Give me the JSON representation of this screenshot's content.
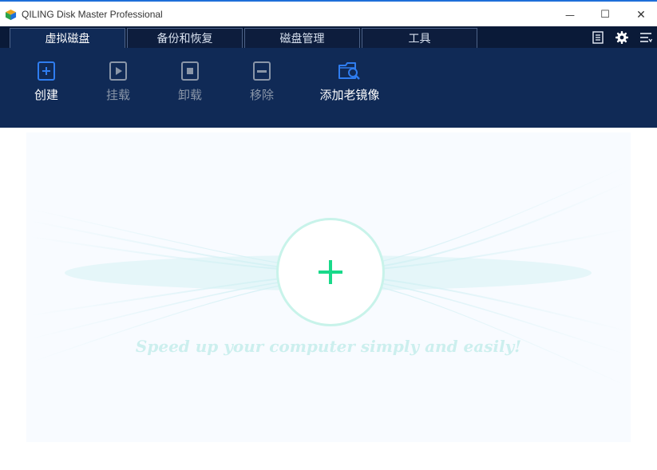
{
  "window": {
    "title": "QILING Disk Master Professional",
    "minimize_glyph": "—",
    "maximize_glyph": "☐",
    "close_glyph": "✕"
  },
  "tabs": [
    {
      "label": "虚拟磁盘",
      "active": true
    },
    {
      "label": "备份和恢复",
      "active": false
    },
    {
      "label": "磁盘管理",
      "active": false
    },
    {
      "label": "工具",
      "active": false
    }
  ],
  "top_icons": [
    "notes-icon",
    "gear-icon",
    "menu-icon"
  ],
  "toolbar": {
    "create": {
      "label": "创建",
      "icon": "create-plus-icon",
      "enabled": true
    },
    "mount": {
      "label": "挂载",
      "icon": "mount-play-icon",
      "enabled": false
    },
    "unmount": {
      "label": "卸载",
      "icon": "unmount-stop-icon",
      "enabled": false
    },
    "remove": {
      "label": "移除",
      "icon": "remove-minus-icon",
      "enabled": false
    },
    "add_image": {
      "label": "添加老镜像",
      "icon": "folder-search-icon",
      "enabled": true
    }
  },
  "main": {
    "add_button_icon": "plus-icon",
    "slogan": "Speed up your computer simply and easily!"
  },
  "colors": {
    "accent_blue": "#1e6fd9",
    "toolbar_bg": "#102a56",
    "tabbar_bg": "#0a1a38",
    "plus_green": "#19d98a",
    "disabled_gray": "#8a96a8"
  }
}
